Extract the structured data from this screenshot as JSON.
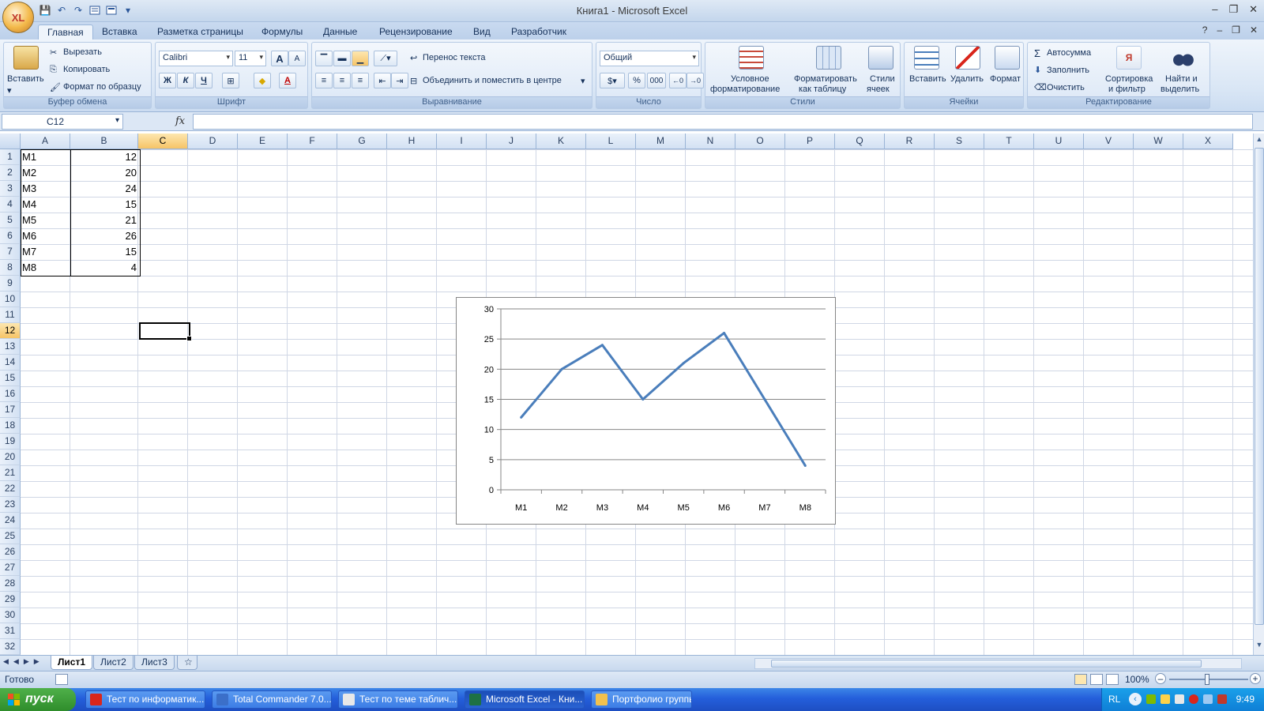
{
  "window": {
    "title": "Книга1 - Microsoft Excel",
    "office_button_glyph": "XL"
  },
  "qat": {
    "save": "💾",
    "undo": "↶",
    "redo": "↷",
    "more": "▾"
  },
  "tabs": [
    "Главная",
    "Вставка",
    "Разметка страницы",
    "Формулы",
    "Данные",
    "Рецензирование",
    "Вид",
    "Разработчик"
  ],
  "ribbon": {
    "clipboard": {
      "label": "Буфер обмена",
      "paste": "Вставить",
      "cut": "Вырезать",
      "copy": "Копировать",
      "format_painter": "Формат по образцу"
    },
    "font": {
      "label": "Шрифт",
      "name": "Calibri",
      "size": "11",
      "grow": "A",
      "shrink": "A",
      "bold": "Ж",
      "italic": "К",
      "underline": "Ч",
      "font_color": "A"
    },
    "alignment": {
      "label": "Выравнивание",
      "wrap": "Перенос текста",
      "merge": "Объединить и поместить в центре"
    },
    "number": {
      "label": "Число",
      "format": "Общий",
      "percent": "%",
      "thousands": "000"
    },
    "styles": {
      "label": "Стили",
      "conditional_1": "Условное",
      "conditional_2": "форматирование",
      "table_1": "Форматировать",
      "table_2": "как таблицу",
      "cell_1": "Стили",
      "cell_2": "ячеек"
    },
    "cells": {
      "label": "Ячейки",
      "insert": "Вставить",
      "delete": "Удалить",
      "format": "Формат"
    },
    "editing": {
      "label": "Редактирование",
      "autosum": "Автосумма",
      "fill": "Заполнить",
      "clear": "Очистить",
      "sort_1": "Сортировка",
      "sort_2": "и фильтр",
      "find_1": "Найти и",
      "find_2": "выделить"
    }
  },
  "formula_bar": {
    "name_box": "C12",
    "fx": "fx",
    "value": ""
  },
  "columns": [
    "A",
    "B",
    "C",
    "D",
    "E",
    "F",
    "G",
    "H",
    "I",
    "J",
    "K",
    "L",
    "M",
    "N",
    "O",
    "P",
    "Q",
    "R",
    "S",
    "T",
    "U",
    "V",
    "W",
    "X"
  ],
  "rows": [
    "1",
    "2",
    "3",
    "4",
    "5",
    "6",
    "7",
    "8",
    "9",
    "10",
    "11",
    "12",
    "13",
    "14",
    "15",
    "16",
    "17",
    "18",
    "19",
    "20",
    "21",
    "22",
    "23",
    "24",
    "25",
    "26",
    "27",
    "28",
    "29",
    "30",
    "31",
    "32"
  ],
  "selected": {
    "column": "C",
    "row": "12"
  },
  "table": [
    {
      "a": "M1",
      "b": "12"
    },
    {
      "a": "M2",
      "b": "20"
    },
    {
      "a": "M3",
      "b": "24"
    },
    {
      "a": "M4",
      "b": "15"
    },
    {
      "a": "M5",
      "b": "21"
    },
    {
      "a": "M6",
      "b": "26"
    },
    {
      "a": "M7",
      "b": "15"
    },
    {
      "a": "M8",
      "b": "4"
    }
  ],
  "chart_data": {
    "type": "line",
    "categories": [
      "M1",
      "M2",
      "M3",
      "M4",
      "M5",
      "M6",
      "M7",
      "M8"
    ],
    "series": [
      {
        "values": [
          12,
          20,
          24,
          15,
          21,
          26,
          15,
          4
        ],
        "color": "#4a7ebb"
      }
    ],
    "ylim": [
      0,
      30
    ],
    "yticks": [
      "0",
      "5",
      "10",
      "15",
      "20",
      "25",
      "30"
    ],
    "grid": true,
    "legend": "none"
  },
  "sheets": [
    "Лист1",
    "Лист2",
    "Лист3"
  ],
  "status": {
    "ready": "Готово",
    "zoom": "100%"
  },
  "taskbar": {
    "start": "пуск",
    "items": [
      {
        "label": "Тест по информатик...",
        "color": "#d9261c"
      },
      {
        "label": "Total Commander 7.0...",
        "color": "#3b6fc9"
      },
      {
        "label": "Тест по теме таблич...",
        "color": "#e8e8e8"
      },
      {
        "label": "Microsoft Excel - Кни...",
        "color": "#1e7145"
      },
      {
        "label": "Портфолио группы",
        "color": "#f2c14e"
      }
    ],
    "lang": "RL",
    "clock": "9:49"
  }
}
